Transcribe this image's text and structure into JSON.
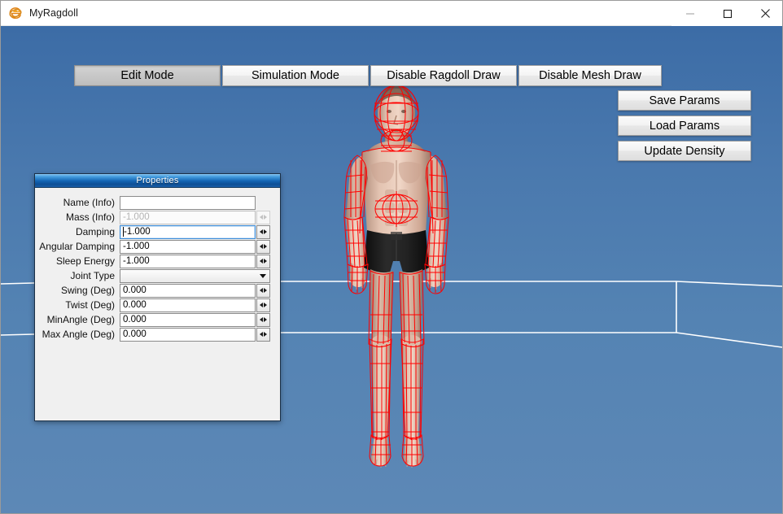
{
  "window": {
    "title": "MyRagdoll",
    "icon": "ie-e-icon",
    "controls": {
      "minimize": "minimize-icon",
      "maximize": "maximize-icon",
      "close": "close-icon"
    }
  },
  "toolbar": {
    "tabs": [
      {
        "label": "Edit Mode",
        "active": true
      },
      {
        "label": "Simulation Mode",
        "active": false
      },
      {
        "label": "Disable Ragdoll Draw",
        "active": false
      },
      {
        "label": "Disable Mesh Draw",
        "active": false
      }
    ]
  },
  "actions": [
    {
      "label": "Save Params"
    },
    {
      "label": "Load Params"
    },
    {
      "label": "Update Density"
    }
  ],
  "properties_panel": {
    "title": "Properties",
    "rows": [
      {
        "label": "Name (Info)",
        "value": "",
        "type": "text",
        "disabled": false,
        "focused": false,
        "spinner": false
      },
      {
        "label": "Mass (Info)",
        "value": "-1.000",
        "type": "number",
        "disabled": true,
        "focused": false,
        "spinner": true
      },
      {
        "label": "Damping",
        "value": "-1.000",
        "type": "number",
        "disabled": false,
        "focused": true,
        "spinner": true
      },
      {
        "label": "Angular Damping",
        "value": "-1.000",
        "type": "number",
        "disabled": false,
        "focused": false,
        "spinner": true
      },
      {
        "label": "Sleep Energy",
        "value": "-1.000",
        "type": "number",
        "disabled": false,
        "focused": false,
        "spinner": true
      },
      {
        "label": "Joint Type",
        "value": "",
        "type": "combo",
        "disabled": false,
        "focused": false,
        "spinner": false
      },
      {
        "label": "Swing (Deg)",
        "value": "0.000",
        "type": "number",
        "disabled": false,
        "focused": false,
        "spinner": true
      },
      {
        "label": "Twist (Deg)",
        "value": "0.000",
        "type": "number",
        "disabled": false,
        "focused": false,
        "spinner": true
      },
      {
        "label": "MinAngle (Deg)",
        "value": "0.000",
        "type": "number",
        "disabled": false,
        "focused": false,
        "spinner": true
      },
      {
        "label": "Max Angle (Deg)",
        "value": "0.000",
        "type": "number",
        "disabled": false,
        "focused": false,
        "spinner": true
      }
    ]
  },
  "viewport": {
    "scene": "3d-ragdoll-character-scene",
    "colors": {
      "sky_top": "#3c6ca6",
      "sky_bottom": "#5d88b6",
      "ground_lines": "#ffffff",
      "ragdoll_wireframe": "#ff0000",
      "shorts": "#1a1a1a",
      "skin": "#e0bfae"
    }
  }
}
